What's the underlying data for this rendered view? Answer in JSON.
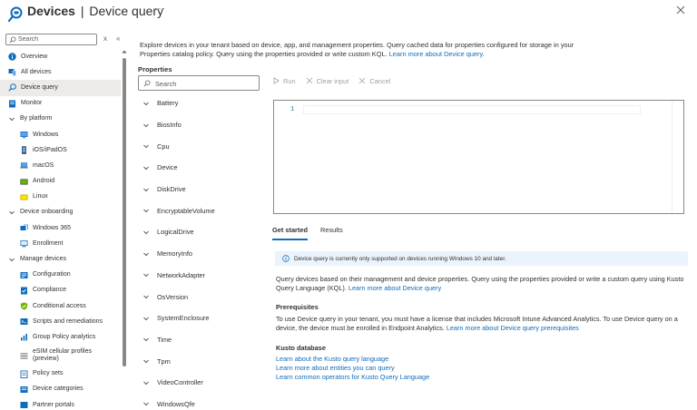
{
  "header": {
    "title_main": "Devices",
    "title_separator": "|",
    "title_sub": "Device query",
    "more": "···"
  },
  "sidebar": {
    "search_placeholder": "Search",
    "clear_glyph": "x",
    "collapse_glyph": "«",
    "items": [
      {
        "label": "Overview",
        "icon": "info-icon",
        "level": 0
      },
      {
        "label": "All devices",
        "icon": "devices-icon",
        "level": 0
      },
      {
        "label": "Device query",
        "icon": "query-icon",
        "level": 0,
        "active": true
      },
      {
        "label": "Monitor",
        "icon": "monitor-icon",
        "level": 0
      },
      {
        "label": "By platform",
        "icon": "chevron-down-icon",
        "level": 0,
        "group": true
      },
      {
        "label": "Windows",
        "icon": "windows-icon",
        "level": 1
      },
      {
        "label": "iOS/iPadOS",
        "icon": "phone-icon",
        "level": 1
      },
      {
        "label": "macOS",
        "icon": "laptop-icon",
        "level": 1
      },
      {
        "label": "Android",
        "icon": "android-icon",
        "level": 1
      },
      {
        "label": "Linux",
        "icon": "linux-icon",
        "level": 1
      },
      {
        "label": "Device onboarding",
        "icon": "chevron-down-icon",
        "level": 0,
        "group": true
      },
      {
        "label": "Windows 365",
        "icon": "windows365-icon",
        "level": 1
      },
      {
        "label": "Enrollment",
        "icon": "enrollment-icon",
        "level": 1
      },
      {
        "label": "Manage devices",
        "icon": "chevron-down-icon",
        "level": 0,
        "group": true
      },
      {
        "label": "Configuration",
        "icon": "configuration-icon",
        "level": 1
      },
      {
        "label": "Compliance",
        "icon": "compliance-icon",
        "level": 1
      },
      {
        "label": "Conditional access",
        "icon": "shield-icon",
        "level": 1
      },
      {
        "label": "Scripts and remediations",
        "icon": "scripts-icon",
        "level": 1
      },
      {
        "label": "Group Policy analytics",
        "icon": "analytics-icon",
        "level": 1
      },
      {
        "label": "eSIM cellular profiles\n(preview)",
        "icon": "esim-icon",
        "level": 1,
        "tall": true
      },
      {
        "label": "Policy sets",
        "icon": "policy-sets-icon",
        "level": 1
      },
      {
        "label": "Device categories",
        "icon": "categories-icon",
        "level": 1
      },
      {
        "label": "Partner portals",
        "icon": "partner-icon",
        "level": 1
      }
    ]
  },
  "main": {
    "intro_text": "Explore devices in your tenant based on device, app, and management properties. Query cached data for properties configured for storage in your Properties catalog policy. Query using the properties provided or write custom KQL.",
    "intro_link": "Learn more about Device query.",
    "properties_title": "Properties",
    "properties_search_placeholder": "Search",
    "properties": [
      "Battery",
      "BiosInfo",
      "Cpu",
      "Device",
      "DiskDrive",
      "EncryptableVolume",
      "LogicalDrive",
      "MemoryInfo",
      "NetworkAdapter",
      "OsVersion",
      "SystemEnclosure",
      "Time",
      "Tpm",
      "VideoController",
      "WindowsQfe"
    ],
    "toolbar": {
      "run": "Run",
      "clear": "Clear input",
      "cancel": "Cancel"
    },
    "editor": {
      "line_number": "1"
    },
    "tabs": [
      {
        "label": "Get started",
        "active": true
      },
      {
        "label": "Results",
        "active": false
      }
    ],
    "info_text": "Device query is currently only supported on devices running Windows 10 and later.",
    "description": "Query devices based on their management and device properties. Query using the properties provided or write a custom query using Kusto Query Language (KQL).",
    "description_link": "Learn more about Device query",
    "prereq_title": "Prerequisites",
    "prereq_text": "To use Device query in your tenant, you must have a license that includes Microsoft Intune Advanced Analytics. To use Device query on a device, the device must be enrolled in Endpoint Analytics.",
    "prereq_link": "Learn more about Device query prerequisites",
    "kusto_title": "Kusto database",
    "kusto_links": [
      "Learn about the Kusto query language",
      "Learn more about entities you can query",
      "Learn common operators for Kusto Query Language"
    ]
  },
  "colors": {
    "accent": "#0f6cbd",
    "info_bg": "#ebf3fc",
    "active_nav_bg": "#edebe9",
    "text": "#323130"
  }
}
